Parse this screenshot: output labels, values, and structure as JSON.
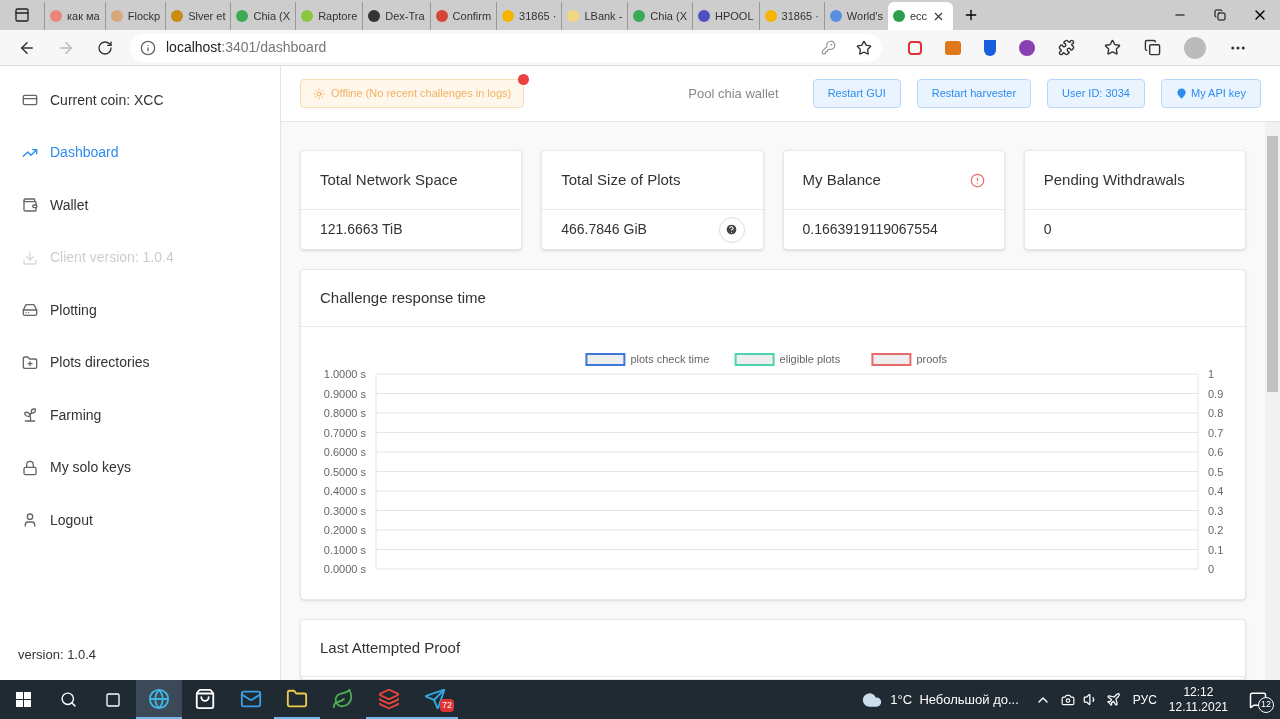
{
  "browser": {
    "tabs": [
      {
        "title": "как ма",
        "color": "#e8877a",
        "selected": false
      },
      {
        "title": "Flockp",
        "color": "#d9a77d",
        "selected": false
      },
      {
        "title": "Slver et",
        "color": "#c88a10",
        "selected": false
      },
      {
        "title": "Chia (X",
        "color": "#3aaa55",
        "selected": false
      },
      {
        "title": "Raptore",
        "color": "#8cc63f",
        "selected": false
      },
      {
        "title": "Dex-Tra",
        "color": "#333333",
        "selected": false
      },
      {
        "title": "Confirm",
        "color": "#d44638",
        "selected": false
      },
      {
        "title": "31865 ·",
        "color": "#f4b400",
        "selected": false
      },
      {
        "title": "LBank -",
        "color": "#f2d880",
        "selected": false
      },
      {
        "title": "Chia (X",
        "color": "#3aaa55",
        "selected": false
      },
      {
        "title": "HPOOL",
        "color": "#5050c0",
        "selected": false
      },
      {
        "title": "31865 ·",
        "color": "#f4b400",
        "selected": false
      },
      {
        "title": "World's",
        "color": "#5a8ee0",
        "selected": false
      },
      {
        "title": "ecc",
        "color": "#2e9d4e",
        "selected": true
      }
    ],
    "url_host": "localhost",
    "url_path": ":3401/dashboard"
  },
  "sidebar": {
    "items": [
      {
        "kind": "coin",
        "label": "Current coin: XCC",
        "selected": false,
        "disabled": false
      },
      {
        "kind": "chart",
        "label": "Dashboard",
        "selected": true,
        "disabled": false
      },
      {
        "kind": "wallet",
        "label": "Wallet",
        "selected": false,
        "disabled": false
      },
      {
        "kind": "download",
        "label": "Client version: 1.0.4",
        "selected": false,
        "disabled": true
      },
      {
        "kind": "plotting",
        "label": "Plotting",
        "selected": false,
        "disabled": false
      },
      {
        "kind": "folder",
        "label": "Plots directories",
        "selected": false,
        "disabled": false
      },
      {
        "kind": "farming",
        "label": "Farming",
        "selected": false,
        "disabled": false
      },
      {
        "kind": "lock",
        "label": "My solo keys",
        "selected": false,
        "disabled": false
      },
      {
        "kind": "user",
        "label": "Logout",
        "selected": false,
        "disabled": false
      }
    ],
    "version": "version: 1.0.4"
  },
  "header": {
    "status": "Offline (No recent challenges in logs)",
    "wallet_label": "Pool chia wallet",
    "buttons": [
      {
        "label": "Restart GUI"
      },
      {
        "label": "Restart harvester"
      },
      {
        "label": "User ID: 3034"
      },
      {
        "label": "My API key",
        "icon": true
      }
    ]
  },
  "stats": [
    {
      "title": "Total Network Space",
      "value": "121.6663 TiB",
      "kind": "plain"
    },
    {
      "title": "Total Size of Plots",
      "value": "466.7846 GiB",
      "kind": "help"
    },
    {
      "title": "My Balance",
      "value": "0.1663919119067554",
      "kind": "warning"
    },
    {
      "title": "Pending Withdrawals",
      "value": "0",
      "kind": "plain"
    }
  ],
  "challenge_card": {
    "title": "Challenge response time",
    "chart_data": {
      "type": "line",
      "series": [
        {
          "name": "plots check time",
          "color": "#3b78d8"
        },
        {
          "name": "eligible plots",
          "color": "#4bd4b0"
        },
        {
          "name": "proofs",
          "color": "#e86a6a"
        }
      ],
      "ylim": [
        0,
        1
      ],
      "y2lim": [
        0,
        1
      ],
      "grid": true,
      "yticks": [
        {
          "value": 1,
          "label": "1.0000 s"
        },
        {
          "value": 0.9,
          "label": "0.9000 s"
        },
        {
          "value": 0.8,
          "label": "0.8000 s"
        },
        {
          "value": 0.7,
          "label": "0.7000 s"
        },
        {
          "value": 0.6,
          "label": "0.6000 s"
        },
        {
          "value": 0.5,
          "label": "0.5000 s"
        },
        {
          "value": 0.4,
          "label": "0.4000 s"
        },
        {
          "value": 0.3,
          "label": "0.3000 s"
        },
        {
          "value": 0.2,
          "label": "0.2000 s"
        },
        {
          "value": 0.1,
          "label": "0.1000 s"
        },
        {
          "value": 0,
          "label": "0.0000 s"
        }
      ],
      "y2ticks": [
        {
          "value": 1,
          "label": "1"
        },
        {
          "value": 0.9,
          "label": "0.9"
        },
        {
          "value": 0.8,
          "label": "0.8"
        },
        {
          "value": 0.7,
          "label": "0.7"
        },
        {
          "value": 0.6,
          "label": "0.6"
        },
        {
          "value": 0.5,
          "label": "0.5"
        },
        {
          "value": 0.4,
          "label": "0.4"
        },
        {
          "value": 0.3,
          "label": "0.3"
        },
        {
          "value": 0.2,
          "label": "0.2"
        },
        {
          "value": 0.1,
          "label": "0.1"
        },
        {
          "value": 0,
          "label": "0"
        }
      ]
    }
  },
  "proof_card": {
    "title": "Last Attempted Proof"
  },
  "taskbar": {
    "apps": [
      {
        "kind": "edge",
        "selected": true,
        "running": true
      },
      {
        "kind": "store",
        "selected": false,
        "running": false
      },
      {
        "kind": "mail",
        "selected": false,
        "running": false
      },
      {
        "kind": "explorer",
        "selected": false,
        "running": true
      },
      {
        "kind": "leaf",
        "selected": false,
        "running": false
      },
      {
        "kind": "anydesk",
        "selected": false,
        "running": true
      },
      {
        "kind": "telegram",
        "selected": false,
        "running": true,
        "badge": "72"
      }
    ],
    "weather": "1°C  Небольшой до...",
    "language": "РУС",
    "time": "12:12",
    "date": "12.11.2021",
    "notifications": "12"
  }
}
